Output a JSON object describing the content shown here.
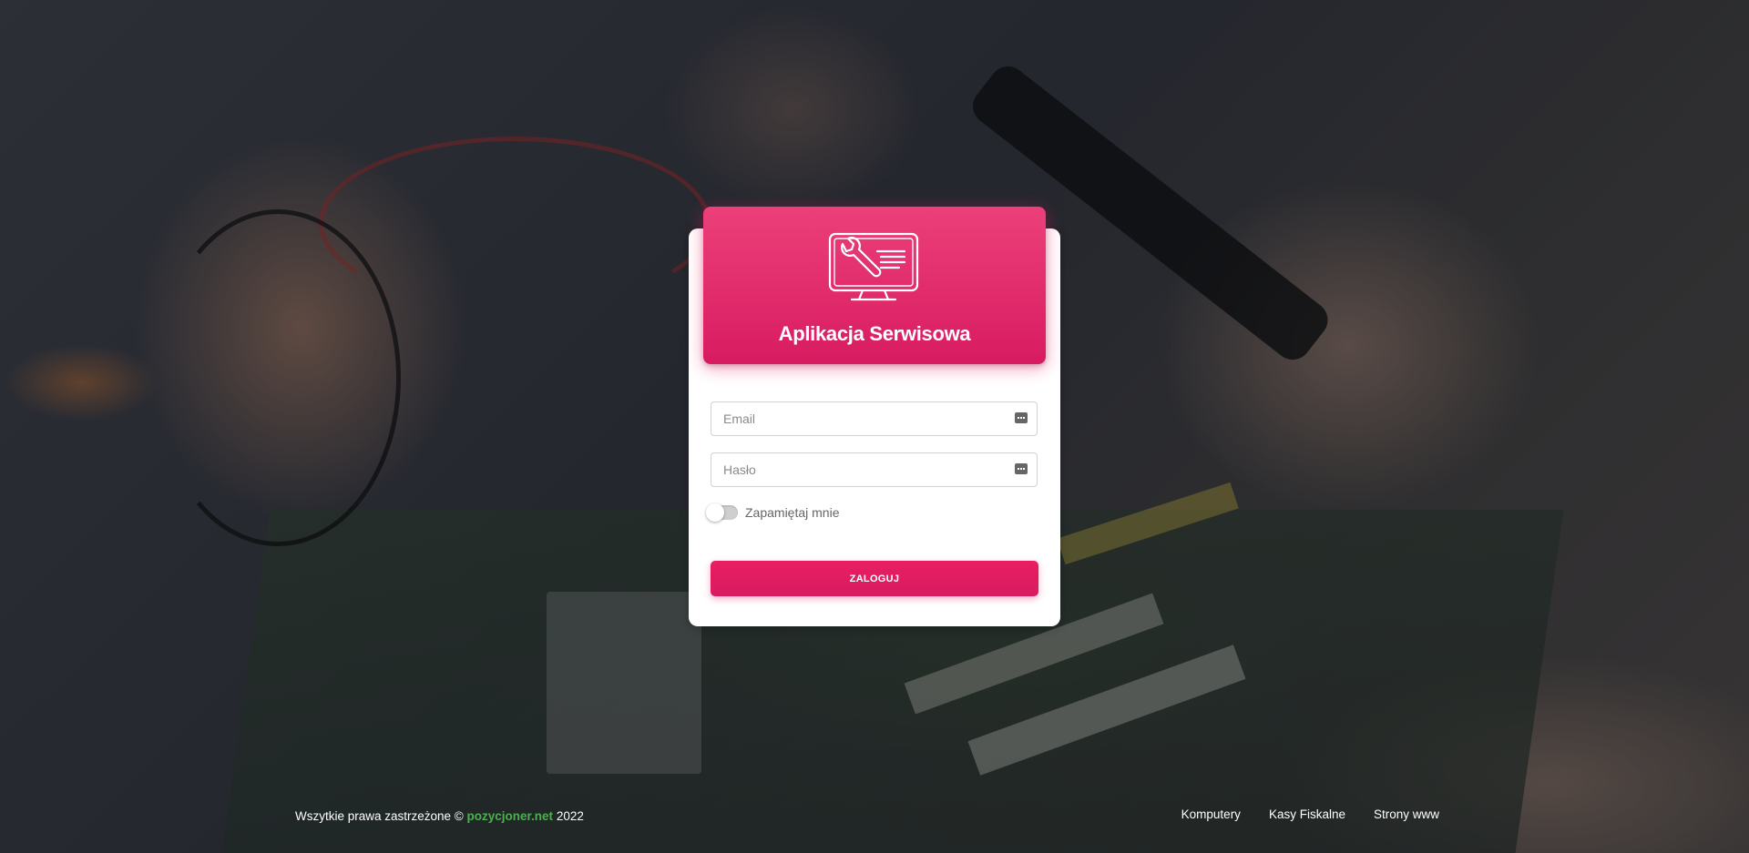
{
  "app": {
    "title": "Aplikacja Serwisowa",
    "logo_icon": "computer-repair-wrench-icon"
  },
  "login_form": {
    "email_placeholder": "Email",
    "email_value": "",
    "password_placeholder": "Hasło",
    "password_value": "",
    "field_icon": "password-manager-icon",
    "remember_label": "Zapamiętaj mnie",
    "remember_checked": false,
    "submit_label": "ZALOGUJ"
  },
  "footer": {
    "copyright_prefix": "Wszytkie prawa zastrzeżone ©",
    "brand": "pozycjoner.net",
    "year": "2022",
    "links": [
      "Komputery",
      "Kasy Fiskalne",
      "Strony www"
    ]
  },
  "colors": {
    "accent": "#e91e63",
    "header_gradient_top": "#ec407a",
    "brand_link": "#4caf50"
  }
}
